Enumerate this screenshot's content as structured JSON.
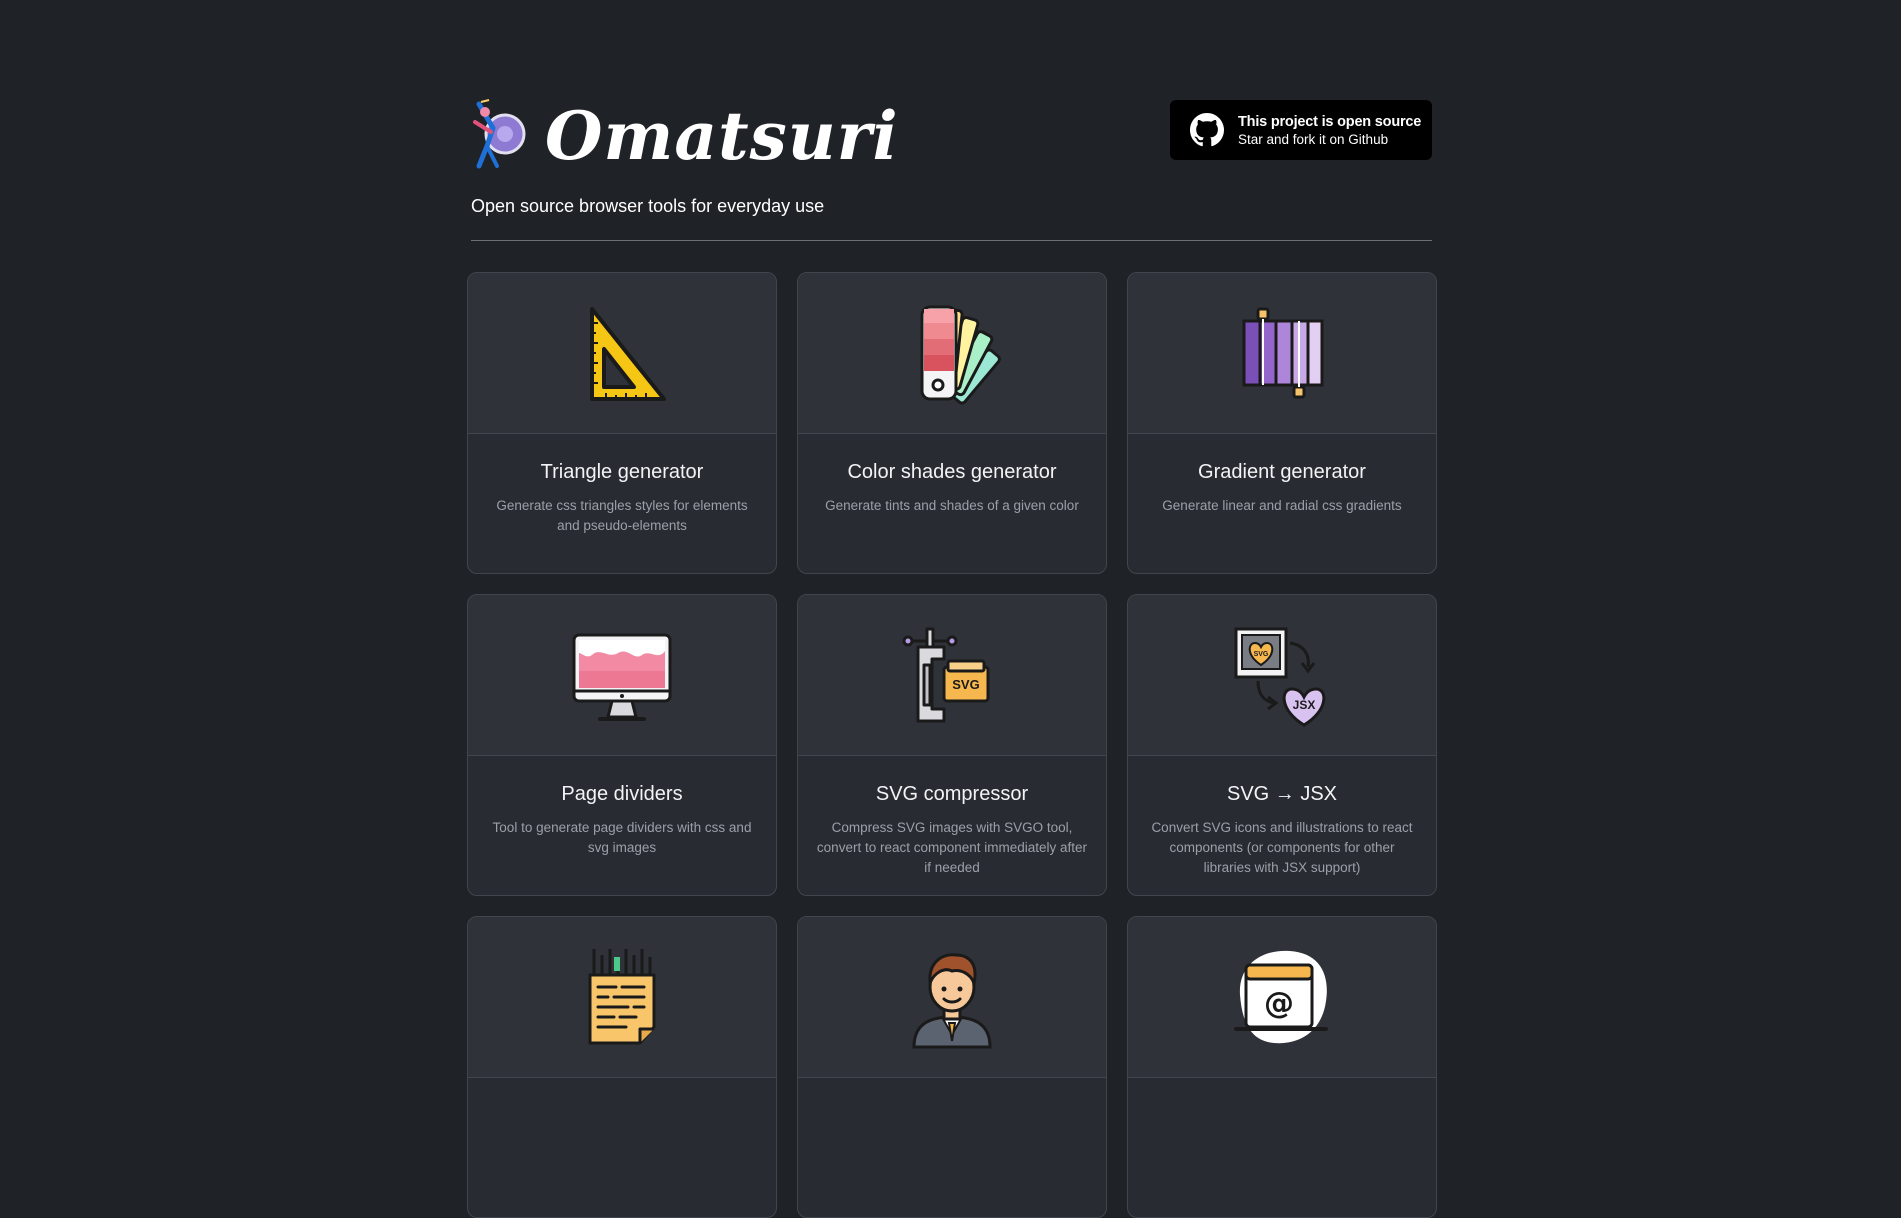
{
  "header": {
    "logo_text": "Omatsuri",
    "subtitle": "Open source browser tools for everyday use",
    "github": {
      "title": "This project is open source",
      "subtitle": "Star and fork it on Github",
      "icon": "github-icon"
    }
  },
  "tools": [
    {
      "title": "Triangle generator",
      "description": "Generate css triangles styles for elements and pseudo-elements",
      "icon": "triangle-ruler-icon"
    },
    {
      "title": "Color shades generator",
      "description": "Generate tints and shades of a given color",
      "icon": "color-palette-icon"
    },
    {
      "title": "Gradient generator",
      "description": "Generate linear and radial css gradients",
      "icon": "gradient-icon"
    },
    {
      "title": "Page dividers",
      "description": "Tool to generate page dividers with css and svg images",
      "icon": "monitor-icon"
    },
    {
      "title": "SVG compressor",
      "description": "Compress SVG images with SVGO tool, convert to react component immediately after if needed",
      "icon": "svg-clamp-icon"
    },
    {
      "title": "SVG → JSX",
      "description": "Convert SVG icons and illustrations to react components (or components for other libraries with JSX support)",
      "icon": "svg-to-jsx-icon"
    },
    {
      "title": "",
      "description": "",
      "icon": "lorem-document-icon"
    },
    {
      "title": "",
      "description": "",
      "icon": "person-icon"
    },
    {
      "title": "",
      "description": "",
      "icon": "email-icon"
    }
  ]
}
